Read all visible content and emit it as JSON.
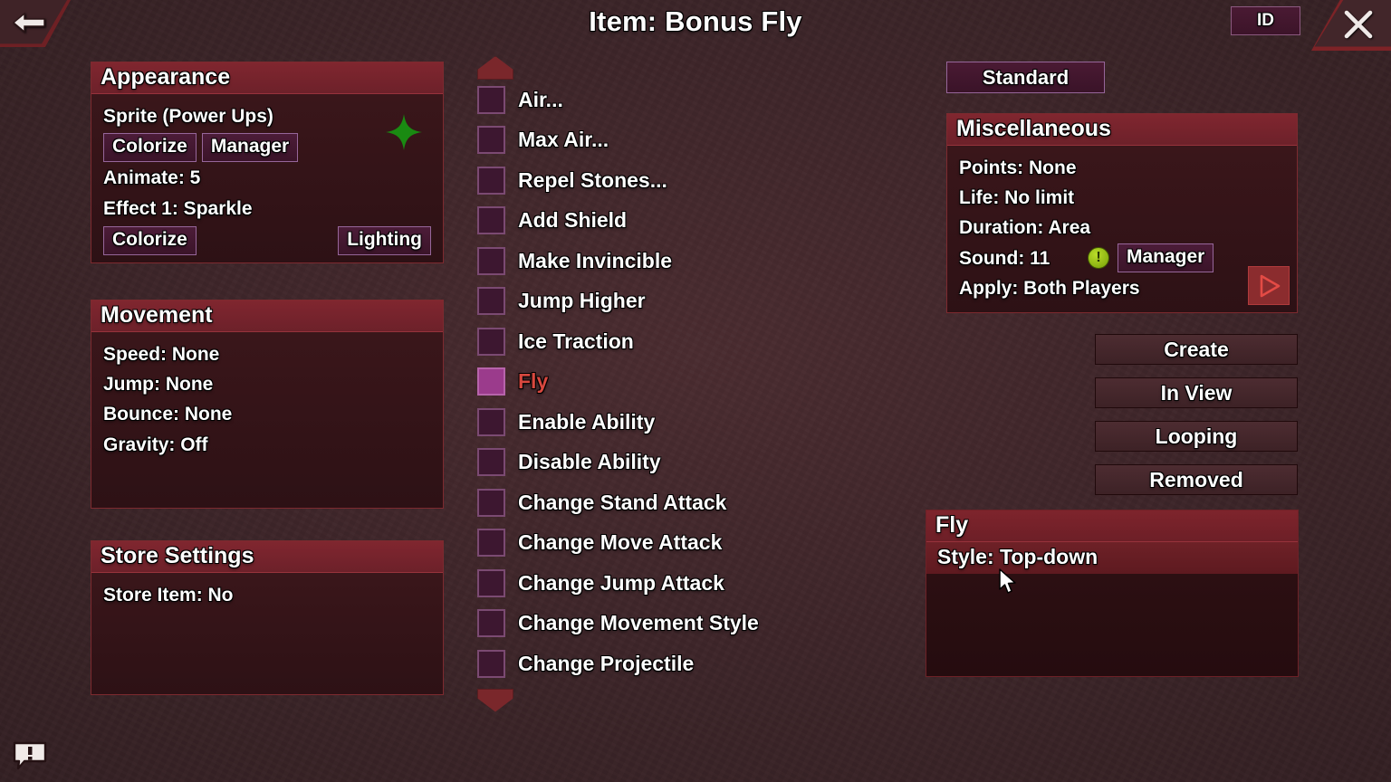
{
  "header": {
    "title": "Item: Bonus Fly",
    "back_icon": "back-arrow-icon",
    "id_label": "ID",
    "close_icon": "close-x-icon"
  },
  "appearance": {
    "title": "Appearance",
    "sprite_label": "Sprite   (Power Ups)",
    "colorize_label": "Colorize",
    "manager_label": "Manager",
    "animate": "Animate: 5",
    "effect": "Effect 1: Sparkle",
    "colorize2_label": "Colorize",
    "lighting_label": "Lighting",
    "sparkle_color": "#1a8a12"
  },
  "movement": {
    "title": "Movement",
    "rows": [
      "Speed: None",
      "Jump: None",
      "Bounce: None",
      "Gravity: Off"
    ]
  },
  "store": {
    "title": "Store Settings",
    "rows": [
      "Store Item: No"
    ]
  },
  "checklist": {
    "scroll_up_icon": "scroll-up-arrow-icon",
    "scroll_down_icon": "scroll-down-arrow-icon",
    "active_color": "#d9483f",
    "items": [
      {
        "label": "Air...",
        "checked": false
      },
      {
        "label": "Max Air...",
        "checked": false
      },
      {
        "label": "Repel Stones...",
        "checked": false
      },
      {
        "label": "Add Shield",
        "checked": false
      },
      {
        "label": "Make Invincible",
        "checked": false
      },
      {
        "label": "Jump Higher",
        "checked": false
      },
      {
        "label": "Ice Traction",
        "checked": false
      },
      {
        "label": "Fly",
        "checked": true
      },
      {
        "label": "Enable Ability",
        "checked": false
      },
      {
        "label": "Disable Ability",
        "checked": false
      },
      {
        "label": "Change Stand Attack",
        "checked": false
      },
      {
        "label": "Change Move Attack",
        "checked": false
      },
      {
        "label": "Change Jump Attack",
        "checked": false
      },
      {
        "label": "Change Movement Style",
        "checked": false
      },
      {
        "label": "Change Projectile",
        "checked": false
      }
    ]
  },
  "right": {
    "standard_label": "Standard",
    "misc": {
      "title": "Miscellaneous",
      "points": "Points: None",
      "life": "Life: No limit",
      "duration": "Duration: Area",
      "sound_label": "Sound: 11",
      "warn_icon": "exclamation-circle-icon",
      "manager_label": "Manager",
      "play_icon": "play-triangle-icon",
      "apply": "Apply: Both Players"
    },
    "actions": [
      "Create",
      "In View",
      "Looping",
      "Removed"
    ],
    "fly_panel": {
      "title": "Fly",
      "style_row": "Style: Top-down"
    }
  },
  "footer": {
    "bubble_icon": "speech-bubble-alert-icon"
  }
}
